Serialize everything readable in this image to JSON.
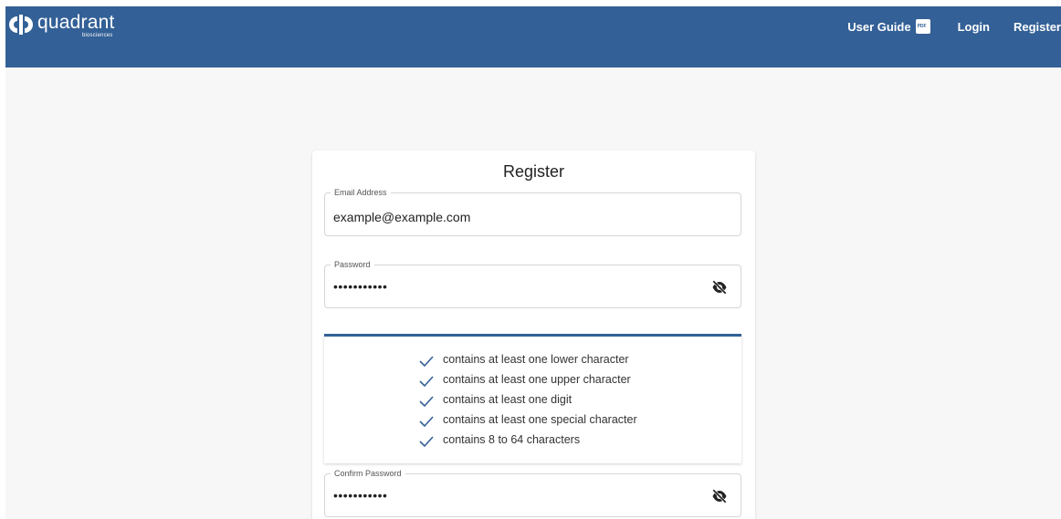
{
  "brand": {
    "name": "quadrant",
    "sub": "biosciences",
    "color": "#336096"
  },
  "nav": {
    "user_guide": "User Guide",
    "pdf_label": "PDF",
    "login": "Login",
    "register": "Register"
  },
  "form": {
    "title": "Register",
    "email": {
      "label": "Email Address",
      "value": "example@example.com"
    },
    "password": {
      "label": "Password",
      "value": "•••••••••••"
    },
    "confirm_password": {
      "label": "Confirm Password",
      "value": "•••••••••••"
    },
    "requirements": [
      {
        "text": "contains at least one lower character",
        "met": true
      },
      {
        "text": "contains at least one upper character",
        "met": true
      },
      {
        "text": "contains at least one digit",
        "met": true
      },
      {
        "text": "contains at least one special character",
        "met": true
      },
      {
        "text": "contains 8 to 64 characters",
        "met": true
      }
    ],
    "icons": {
      "visibility": "eye-off-icon",
      "check": "check-icon"
    }
  }
}
